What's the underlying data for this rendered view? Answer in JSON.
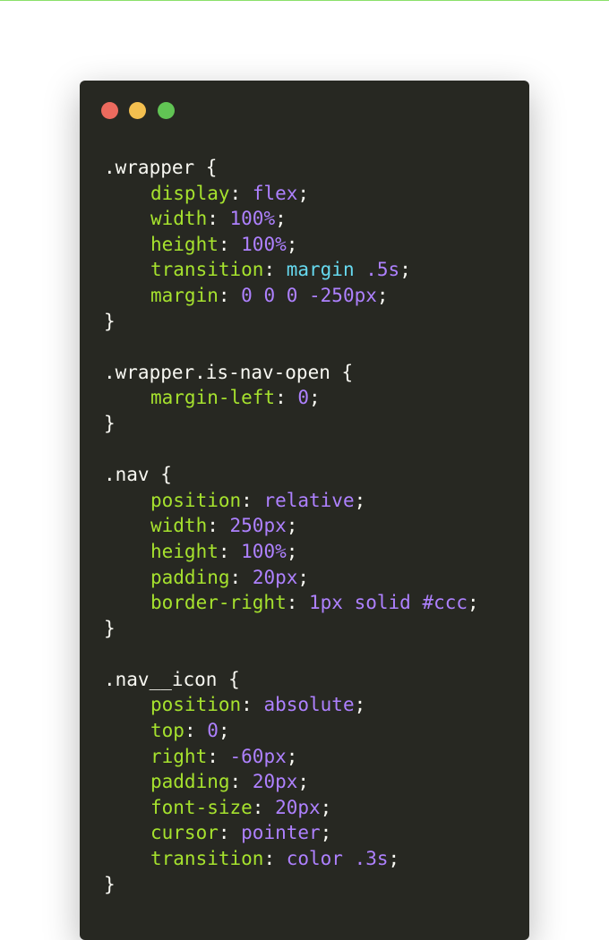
{
  "window": {
    "buttons": [
      "close",
      "minimize",
      "maximize"
    ]
  },
  "code": {
    "blocks": [
      {
        "selector": ".wrapper",
        "decls": [
          {
            "prop": "display",
            "value": "flex"
          },
          {
            "prop": "width",
            "value": "100%"
          },
          {
            "prop": "height",
            "value": "100%"
          },
          {
            "prop": "transition",
            "value_kw": "margin",
            "value": ".5s"
          },
          {
            "prop": "margin",
            "value": "0 0 0 -250px"
          }
        ]
      },
      {
        "selector": ".wrapper.is-nav-open",
        "decls": [
          {
            "prop": "margin-left",
            "value": "0"
          }
        ]
      },
      {
        "selector": ".nav",
        "decls": [
          {
            "prop": "position",
            "value": "relative"
          },
          {
            "prop": "width",
            "value": "250px"
          },
          {
            "prop": "height",
            "value": "100%"
          },
          {
            "prop": "padding",
            "value": "20px"
          },
          {
            "prop": "border-right",
            "value": "1px solid #ccc"
          }
        ]
      },
      {
        "selector": ".nav__icon",
        "decls": [
          {
            "prop": "position",
            "value": "absolute"
          },
          {
            "prop": "top",
            "value": "0"
          },
          {
            "prop": "right",
            "value": "-60px"
          },
          {
            "prop": "padding",
            "value": "20px"
          },
          {
            "prop": "font-size",
            "value": "20px"
          },
          {
            "prop": "cursor",
            "value": "pointer"
          },
          {
            "prop": "transition",
            "value": "color .3s"
          }
        ]
      }
    ],
    "open_brace": " {",
    "close_brace": "}",
    "colon": ": ",
    "semicolon": ";"
  },
  "colors": {
    "background": "#272822",
    "property": "#a6e22e",
    "value": "#ae81ff",
    "keyword": "#66d9ef",
    "text": "#f8f8f2",
    "dot_red": "#ec6a5e",
    "dot_yellow": "#f3bf4f",
    "dot_green": "#61c454"
  }
}
